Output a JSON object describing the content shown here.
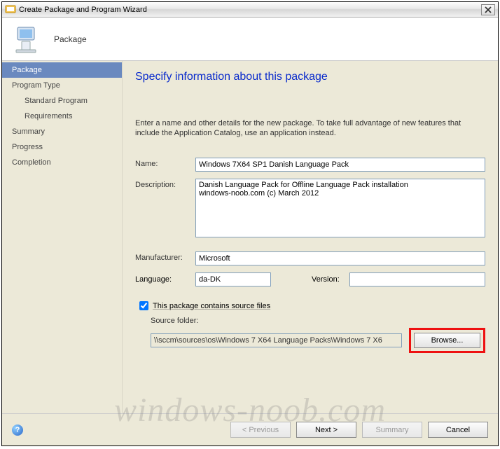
{
  "window": {
    "title": "Create Package and Program Wizard"
  },
  "header": {
    "label": "Package"
  },
  "sidebar": {
    "items": [
      {
        "label": "Package",
        "active": true,
        "sub": false
      },
      {
        "label": "Program Type",
        "active": false,
        "sub": false
      },
      {
        "label": "Standard Program",
        "active": false,
        "sub": true
      },
      {
        "label": "Requirements",
        "active": false,
        "sub": true
      },
      {
        "label": "Summary",
        "active": false,
        "sub": false
      },
      {
        "label": "Progress",
        "active": false,
        "sub": false
      },
      {
        "label": "Completion",
        "active": false,
        "sub": false
      }
    ]
  },
  "page": {
    "heading": "Specify information about this package",
    "intro": "Enter a name and other details for the new package. To take full advantage of new features that include the Application Catalog, use an application instead."
  },
  "form": {
    "name_label": "Name:",
    "name_value": "Windows 7X64 SP1 Danish Language Pack",
    "desc_label": "Description:",
    "desc_value": "Danish Language Pack for Offline Language Pack installation\nwindows-noob.com (c) March 2012",
    "manuf_label": "Manufacturer:",
    "manuf_value": "Microsoft",
    "lang_label": "Language:",
    "lang_value": "da-DK",
    "ver_label": "Version:",
    "ver_value": "",
    "chk_label": "This package contains source files",
    "chk_checked": true,
    "src_label": "Source folder:",
    "src_value": "\\\\sccm\\sources\\os\\Windows 7 X64 Language Packs\\Windows 7 X6",
    "browse_label": "Browse..."
  },
  "footer": {
    "prev": "< Previous",
    "next": "Next >",
    "summary": "Summary",
    "cancel": "Cancel"
  },
  "watermark": "windows-noob.com"
}
